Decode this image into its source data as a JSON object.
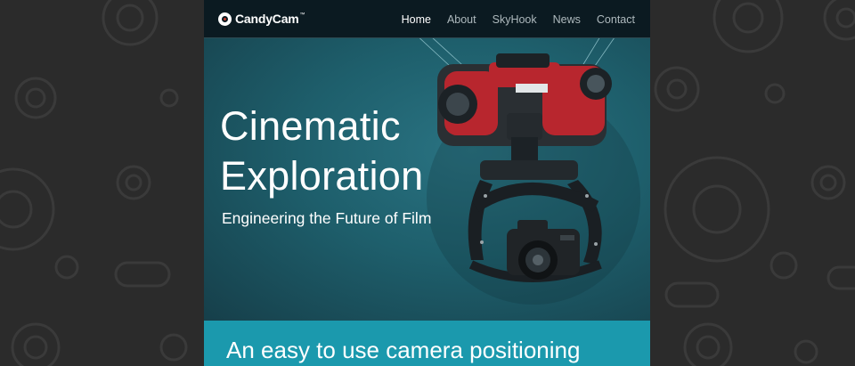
{
  "brand": {
    "name": "CandyCam",
    "trademark": "™"
  },
  "nav": {
    "items": [
      {
        "label": "Home",
        "active": true
      },
      {
        "label": "About",
        "active": false
      },
      {
        "label": "SkyHook",
        "active": false
      },
      {
        "label": "News",
        "active": false
      },
      {
        "label": "Contact",
        "active": false
      }
    ]
  },
  "hero": {
    "headline_line1": "Cinematic",
    "headline_line2": "Exploration",
    "subheadline": "Engineering the Future of Film"
  },
  "feature_band": {
    "text": "An easy to use camera positioning"
  },
  "colors": {
    "page_background": "#2b2b2b",
    "topbar": "#0b1a21",
    "hero": "#1d5866",
    "band": "#1b99ad",
    "rig_red": "#b8262e"
  }
}
